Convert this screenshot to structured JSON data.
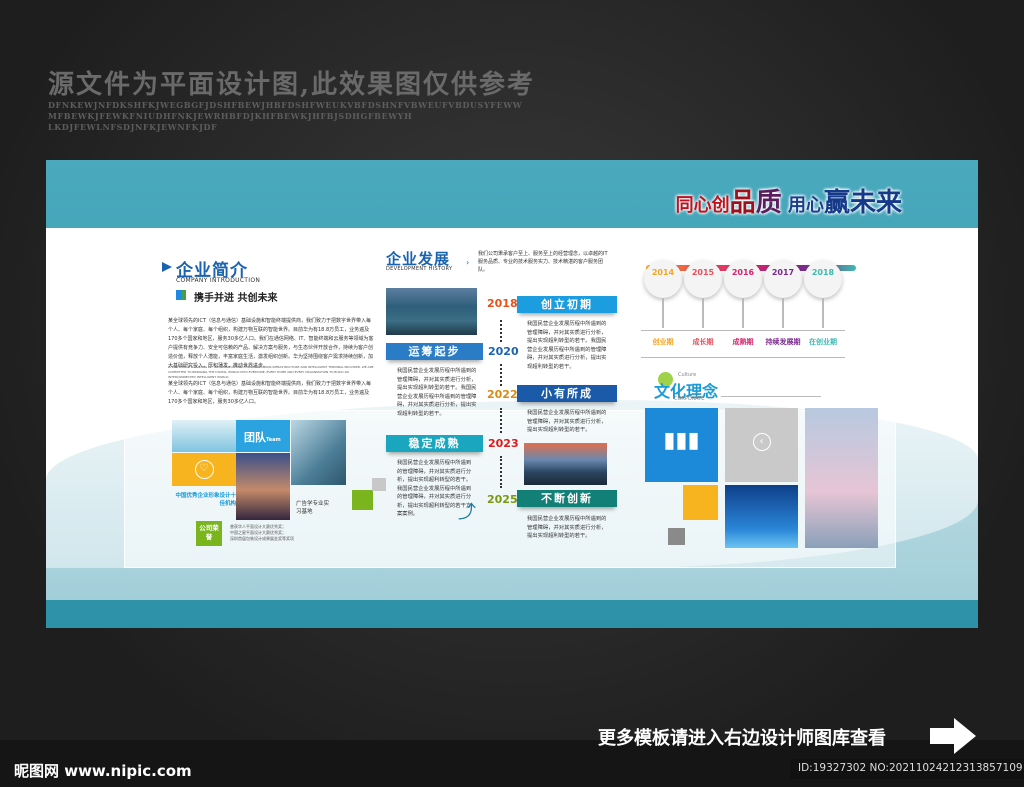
{
  "watermark": {
    "title": "源文件为平面设计图,此效果图仅供参考",
    "lines": [
      "DFNKEWJNFDKSHFKJWEGBGFJDSHFBEWJHBFDSHFWEUKVBFDSHNFVBWEUFVBDUSYFEWW",
      "MFBEWKJFEWKFNIUDHFNKJEWRHBFDJKHFBEWKJHFBJSDHGFBEWYH",
      "LKDJFEWLNFSDJNFKJEWNFKJDF"
    ]
  },
  "slogan": {
    "p1": "同心创",
    "p2": "品",
    "p3": "质",
    "p4": " 用心",
    "p5": "赢未来"
  },
  "intro": {
    "title": "企业简介",
    "subtitle": "COMPANY INTRODUCTION",
    "tagline": "携手并进 共创未来",
    "body1": "某全球领先的ICT（信息与通信）基础设施和智能终端提供商，我们致力于把数字世界带入每个人、每个家庭、每个组织，构建万物互联的智能世界。目前华为有18.8万员工，业务遍及170多个国家和地区，服务30多亿人口。我们在通信网络、IT、智能终端和云服务等领域为客户提供有竞争力、安全可信赖的产品、解决方案与服务，与生态伙伴开放合作，持续为客户创造价值，释放个人潜能，丰富家庭生活，激发组织创新。华为坚持围绕客户需求持续创新，加大基础研究投入，厚积薄发，推动世界进步。",
    "body_en": "IS THE WORLD'S LEADING ICT INFORMATION AND COMMUNICATIONS INFRASTRUCTURE AND INTELLIGENT TERMINAL PROVIDER. WE ARE COMMITTED TO BRINGING THE DIGITAL WORLD INTO EVERYONE, EVERY HOME AND EVERY ORGANIZATION TO BUILD AN INTERCONNECTED INTELLIGENT WORLD.",
    "body2": "某全球领先的ICT（信息与通信）基础设施和智能终端提供商，我们致力于把数字世界带入每个人、每个家庭、每个组织，构建万物互联的智能世界。目前华为有18.8万员工，业务遍及170多个国家和地区，服务30多亿人口。"
  },
  "tiles": {
    "team": "团队",
    "team_en": "Team",
    "award_text": "中国优秀企业形象设计十佳机构",
    "base_text": "广告学专业实习基地",
    "honor": "公司荣誉",
    "honors": [
      "曾获华人平面设计大赛优秀奖；",
      "中国之星平面设计大赛优秀奖；",
      "深圳首届包装设计成果展金奖等奖项"
    ]
  },
  "history": {
    "title": "企业发展",
    "subtitle": "DEVELOPMENT HISTORY",
    "desc": "我们公司秉承客户至上、服务至上的经营理念，以卓越的IT服务品质、专业的技术服务实力、技术精湛的客户服务团队。",
    "items": [
      {
        "year": "2018",
        "label": "创立初期",
        "text": "我国民营企业发展历程中所遇到的管理障碍，并对其实质进行分析，提出实现超利转型的若干。我国民营企业发展历程中所遇到的管理障碍，并对其实质进行分析，提出实现超利转型的若干。"
      },
      {
        "year": "2020",
        "label": "运筹起步",
        "text": "我国民营企业发展历程中所遇到的管理障碍，并对其实质进行分析，提出实现超利转型的若干。我国民营企业发展历程中所遇到的管理障碍，并对其实质进行分析，提出实现超利转型的若干。"
      },
      {
        "year": "2022",
        "label": "小有所成",
        "text": "我国民营企业发展历程中所遇到的管理障碍，并对其实质进行分析，提出实现超利转型的若干。"
      },
      {
        "year": "2023",
        "label": "稳定成熟",
        "text": "我国民营企业发展历程中所遇到的管理障碍，并对其实质进行分析，提出实现超利转型的若干。我国民营企业发展历程中所遇到的管理障碍，并对其实质进行分析，提出实现超利转型的若干方案案例。"
      },
      {
        "year": "2025",
        "label": "不断创新",
        "text": "我国民营企业发展历程中所遇到的管理障碍，并对其实质进行分析，提出实现超利转型的若干。"
      }
    ]
  },
  "stages": [
    {
      "year": "2014",
      "label": "创业期",
      "color": "#f5a623"
    },
    {
      "year": "2015",
      "label": "成长期",
      "color": "#ee4d5a"
    },
    {
      "year": "2016",
      "label": "成熟期",
      "color": "#d6246e"
    },
    {
      "year": "2017",
      "label": "持续发展期",
      "color": "#7a2a8e"
    },
    {
      "year": "2018",
      "label": "在创业期",
      "color": "#3fb8b0"
    }
  ],
  "culture": {
    "title": "文化理念",
    "en_top": "Culture",
    "en_bottom": "CORPORATE"
  },
  "footer": {
    "more": "更多模板请进入右边设计师图库查看",
    "id": "ID:19327302 NO:20211024212313857109",
    "logo": "昵图网 www.nipic.com"
  }
}
